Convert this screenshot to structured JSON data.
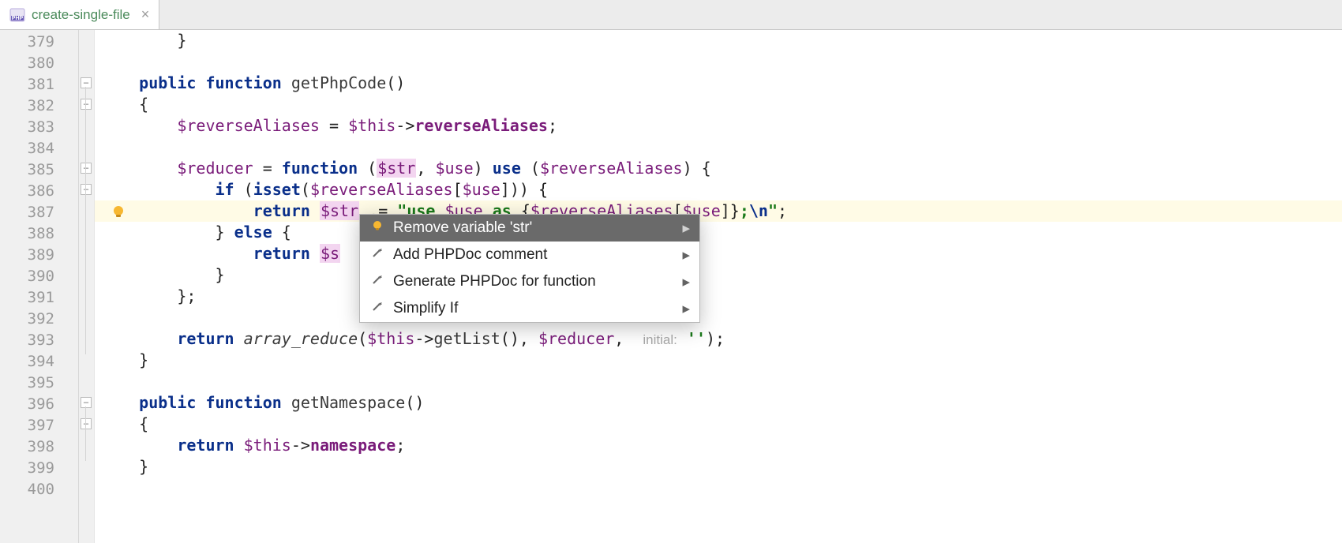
{
  "tab": {
    "filename": "create-single-file",
    "filetype": "PHP"
  },
  "gutter": {
    "start": 379,
    "lines": [
      379,
      380,
      381,
      382,
      383,
      384,
      385,
      386,
      387,
      388,
      389,
      390,
      391,
      392,
      393,
      394,
      395,
      396,
      397,
      398,
      399,
      400
    ],
    "bulb_line": 387
  },
  "code": {
    "lines": [
      {
        "n": 379,
        "tokens": [
          {
            "t": "        }",
            "c": "op"
          }
        ]
      },
      {
        "n": 380,
        "tokens": []
      },
      {
        "n": 381,
        "tokens": [
          {
            "t": "    ",
            "c": ""
          },
          {
            "t": "public function",
            "c": "kw"
          },
          {
            "t": " ",
            "c": ""
          },
          {
            "t": "getPhpCode",
            "c": "fn"
          },
          {
            "t": "()",
            "c": "op"
          }
        ]
      },
      {
        "n": 382,
        "tokens": [
          {
            "t": "    {",
            "c": "op"
          }
        ]
      },
      {
        "n": 383,
        "tokens": [
          {
            "t": "        ",
            "c": ""
          },
          {
            "t": "$reverseAliases",
            "c": "var"
          },
          {
            "t": " = ",
            "c": "op"
          },
          {
            "t": "$this",
            "c": "var"
          },
          {
            "t": "->",
            "c": "op"
          },
          {
            "t": "reverseAliases",
            "c": "prop"
          },
          {
            "t": ";",
            "c": "op"
          }
        ]
      },
      {
        "n": 384,
        "tokens": []
      },
      {
        "n": 385,
        "tokens": [
          {
            "t": "        ",
            "c": ""
          },
          {
            "t": "$reducer",
            "c": "var"
          },
          {
            "t": " = ",
            "c": "op"
          },
          {
            "t": "function",
            "c": "kw"
          },
          {
            "t": " (",
            "c": "op"
          },
          {
            "t": "$str",
            "c": "varhl"
          },
          {
            "t": ", ",
            "c": "op"
          },
          {
            "t": "$use",
            "c": "var"
          },
          {
            "t": ") ",
            "c": "op"
          },
          {
            "t": "use",
            "c": "kw"
          },
          {
            "t": " (",
            "c": "op"
          },
          {
            "t": "$reverseAliases",
            "c": "var"
          },
          {
            "t": ") {",
            "c": "op"
          }
        ]
      },
      {
        "n": 386,
        "tokens": [
          {
            "t": "            ",
            "c": ""
          },
          {
            "t": "if",
            "c": "kw"
          },
          {
            "t": " (",
            "c": "op"
          },
          {
            "t": "isset",
            "c": "kw"
          },
          {
            "t": "(",
            "c": "op"
          },
          {
            "t": "$reverseAliases",
            "c": "var"
          },
          {
            "t": "[",
            "c": "op"
          },
          {
            "t": "$use",
            "c": "var"
          },
          {
            "t": "])) {",
            "c": "op"
          }
        ]
      },
      {
        "n": 387,
        "hl": true,
        "tokens": [
          {
            "t": "                ",
            "c": ""
          },
          {
            "t": "return",
            "c": "kw"
          },
          {
            "t": " ",
            "c": ""
          },
          {
            "t": "$str",
            "c": "varhl"
          },
          {
            "t": " .= ",
            "c": "op"
          },
          {
            "t": "\"use ",
            "c": "str"
          },
          {
            "t": "$use",
            "c": "var"
          },
          {
            "t": " as ",
            "c": "str"
          },
          {
            "t": "{",
            "c": "op"
          },
          {
            "t": "$reverseAliases",
            "c": "var"
          },
          {
            "t": "[",
            "c": "op"
          },
          {
            "t": "$use",
            "c": "var"
          },
          {
            "t": "]}",
            "c": "op"
          },
          {
            "t": ";",
            "c": "str"
          },
          {
            "t": "\\n",
            "c": "esc"
          },
          {
            "t": "\"",
            "c": "str"
          },
          {
            "t": ";",
            "c": "op"
          }
        ]
      },
      {
        "n": 388,
        "tokens": [
          {
            "t": "            } ",
            "c": "op"
          },
          {
            "t": "else",
            "c": "kw"
          },
          {
            "t": " {",
            "c": "op"
          }
        ]
      },
      {
        "n": 389,
        "tokens": [
          {
            "t": "                ",
            "c": ""
          },
          {
            "t": "return",
            "c": "kw"
          },
          {
            "t": " ",
            "c": ""
          },
          {
            "t": "$s",
            "c": "varhl"
          }
        ]
      },
      {
        "n": 390,
        "tokens": [
          {
            "t": "            }",
            "c": "op"
          }
        ]
      },
      {
        "n": 391,
        "tokens": [
          {
            "t": "        };",
            "c": "op"
          }
        ]
      },
      {
        "n": 392,
        "tokens": []
      },
      {
        "n": 393,
        "tokens": [
          {
            "t": "        ",
            "c": ""
          },
          {
            "t": "return",
            "c": "kw"
          },
          {
            "t": " ",
            "c": ""
          },
          {
            "t": "array_reduce",
            "c": "ital"
          },
          {
            "t": "(",
            "c": "op"
          },
          {
            "t": "$this",
            "c": "var"
          },
          {
            "t": "->",
            "c": "op"
          },
          {
            "t": "getList",
            "c": "fn"
          },
          {
            "t": "(), ",
            "c": "op"
          },
          {
            "t": "$reducer",
            "c": "var"
          },
          {
            "t": ",  ",
            "c": "op"
          },
          {
            "t": "initial:",
            "c": "hint"
          },
          {
            "t": " ",
            "c": ""
          },
          {
            "t": "''",
            "c": "str"
          },
          {
            "t": ");",
            "c": "op"
          }
        ]
      },
      {
        "n": 394,
        "tokens": [
          {
            "t": "    }",
            "c": "op"
          }
        ]
      },
      {
        "n": 395,
        "tokens": []
      },
      {
        "n": 396,
        "tokens": [
          {
            "t": "    ",
            "c": ""
          },
          {
            "t": "public function",
            "c": "kw"
          },
          {
            "t": " ",
            "c": ""
          },
          {
            "t": "getNamespace",
            "c": "fn"
          },
          {
            "t": "()",
            "c": "op"
          }
        ]
      },
      {
        "n": 397,
        "tokens": [
          {
            "t": "    {",
            "c": "op"
          }
        ]
      },
      {
        "n": 398,
        "tokens": [
          {
            "t": "        ",
            "c": ""
          },
          {
            "t": "return",
            "c": "kw"
          },
          {
            "t": " ",
            "c": ""
          },
          {
            "t": "$this",
            "c": "var"
          },
          {
            "t": "->",
            "c": "op"
          },
          {
            "t": "namespace",
            "c": "prop"
          },
          {
            "t": ";",
            "c": "op"
          }
        ]
      },
      {
        "n": 399,
        "tokens": [
          {
            "t": "    }",
            "c": "op"
          }
        ]
      },
      {
        "n": 400,
        "tokens": []
      }
    ]
  },
  "popup": {
    "items": [
      {
        "label": "Remove variable 'str'",
        "icon": "bulb",
        "selected": true,
        "submenu": true
      },
      {
        "label": "Add PHPDoc comment",
        "icon": "wand",
        "selected": false,
        "submenu": true
      },
      {
        "label": "Generate PHPDoc for function",
        "icon": "wand",
        "selected": false,
        "submenu": true
      },
      {
        "label": "Simplify If",
        "icon": "wand",
        "selected": false,
        "submenu": true
      }
    ]
  }
}
